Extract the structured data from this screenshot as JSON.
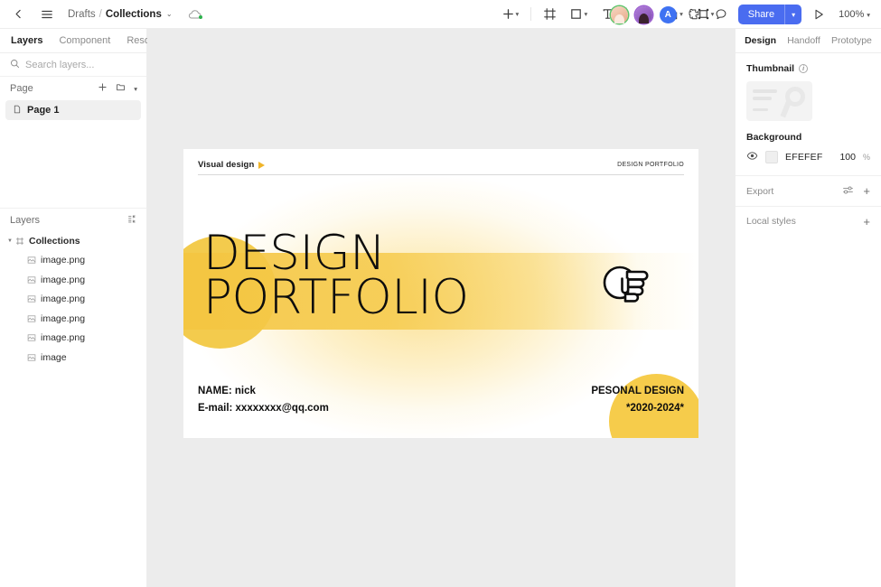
{
  "topbar": {
    "back_icon": "chevron-left-icon",
    "menu_icon": "hamburger-menu-icon",
    "breadcrumb_root": "Drafts",
    "breadcrumb_sep": "/",
    "breadcrumb_current": "Collections",
    "breadcrumb_chevron": "⌄",
    "cloud_icon": "cloud-sync-icon",
    "tools": [
      {
        "name": "add-tool",
        "icon": "plus-icon",
        "has_chevron": true
      },
      {
        "name": "frame-tool",
        "icon": "frame-icon",
        "has_chevron": false
      },
      {
        "name": "shape-tool",
        "icon": "rectangle-icon",
        "has_chevron": true
      },
      {
        "name": "text-tool",
        "icon": "text-icon",
        "has_chevron": false
      },
      {
        "name": "move-tool",
        "icon": "move-icon",
        "has_chevron": false
      },
      {
        "name": "boolean-tool",
        "icon": "boolean-union-icon",
        "has_chevron": true
      },
      {
        "name": "component-tool",
        "icon": "component-icon",
        "has_chevron": true
      }
    ],
    "avatars": [
      {
        "name": "avatar-user-1",
        "initial": ""
      },
      {
        "name": "avatar-user-2",
        "initial": ""
      },
      {
        "name": "avatar-user-3",
        "initial": "A"
      }
    ],
    "plugin_icon": "plugin-icon",
    "comment_icon": "comment-icon",
    "share_label": "Share",
    "share_chevron": "⌄",
    "present_icon": "play-icon",
    "zoom_level": "100%",
    "zoom_chevron": "⌄",
    "share_color": "#4a6cf0"
  },
  "left_panel": {
    "tabs": [
      {
        "label": "Layers",
        "active": true
      },
      {
        "label": "Component",
        "active": false
      },
      {
        "label": "Resource",
        "active": false
      }
    ],
    "search_placeholder": "Search layers...",
    "search_value": "",
    "search_icon": "search-icon",
    "page_section_label": "Page",
    "page_add_icon": "plus-icon",
    "page_folder_icon": "folder-icon",
    "page_collapse_icon": "chevron-down-icon",
    "pages": [
      {
        "label": "Page 1",
        "icon": "page-icon",
        "selected": true
      }
    ],
    "layers_section_label": "Layers",
    "layers_collapse_icon": "collapse-all-icon",
    "layers": [
      {
        "label": "Collections",
        "icon": "frame-icon",
        "depth": 0,
        "expanded": true
      },
      {
        "label": "image.png",
        "icon": "image-icon",
        "depth": 1
      },
      {
        "label": "image.png",
        "icon": "image-icon",
        "depth": 1
      },
      {
        "label": "image.png",
        "icon": "image-icon",
        "depth": 1
      },
      {
        "label": "image.png",
        "icon": "image-icon",
        "depth": 1
      },
      {
        "label": "image.png",
        "icon": "image-icon",
        "depth": 1
      },
      {
        "label": "image",
        "icon": "image-icon",
        "depth": 1
      }
    ]
  },
  "canvas": {
    "background_color": "#ececec",
    "artboard": {
      "eyebrow_label": "Visual design",
      "eyebrow_marker_icon": "play-triangle-icon",
      "corner_label": "DESIGN PORTFOLIO",
      "title_line1": "DESIGN",
      "title_line2": "PORTFOLIO",
      "hand_icon": "pointing-hand-icon",
      "contact_name": "NAME: nick",
      "contact_email": "E-mail: xxxxxxxx@qq.com",
      "footer_line1": "PESONAL DESIGN",
      "footer_line2": "*2020-2024*",
      "accent_color": "#f3cb4d"
    }
  },
  "right_panel": {
    "tabs": [
      {
        "label": "Design",
        "active": true
      },
      {
        "label": "Handoff",
        "active": false
      },
      {
        "label": "Prototype",
        "active": false
      }
    ],
    "thumbnail_label": "Thumbnail",
    "thumbnail_info_icon": "info-icon",
    "background_label": "Background",
    "background_visibility_icon": "eye-icon",
    "background_hex": "EFEFEF",
    "background_opacity": "100",
    "background_opacity_unit": "%",
    "export_label": "Export",
    "export_settings_icon": "sliders-icon",
    "export_add_icon": "plus-icon",
    "local_styles_label": "Local styles",
    "local_styles_add_icon": "plus-icon"
  }
}
